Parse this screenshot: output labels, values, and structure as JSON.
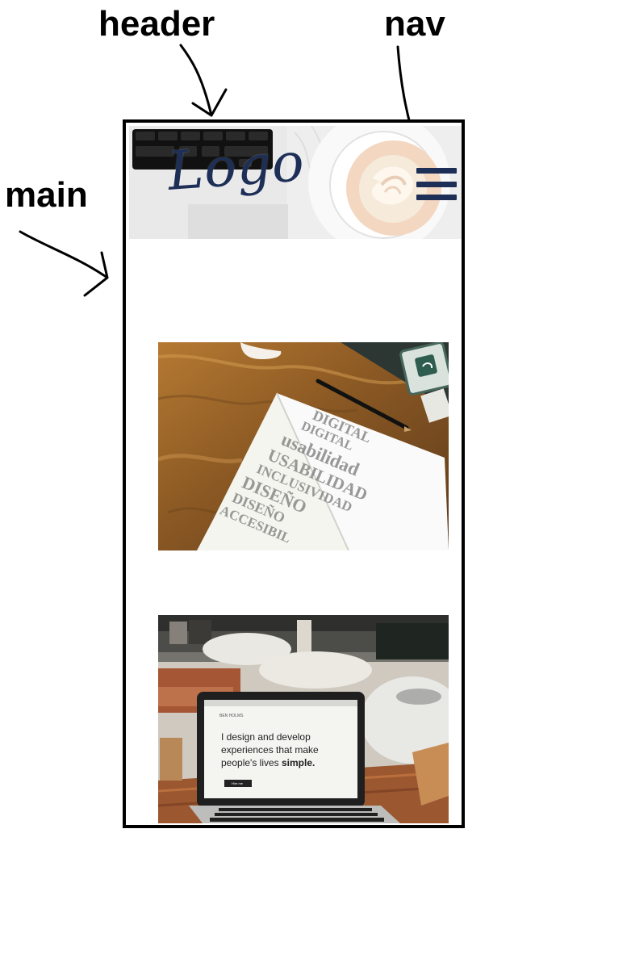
{
  "annotations": {
    "header": "header",
    "nav": "nav",
    "main": "main"
  },
  "site": {
    "logo": "Logo"
  },
  "notebook_image": {
    "lines": [
      "DIGITAL",
      "DIGITAL",
      "usabilidad",
      "USABILIDAD",
      "INCLUSIVIDAD",
      "DISEÑO",
      "DISEÑO",
      "ACCESIBIL"
    ]
  },
  "laptop_image": {
    "site_name": "BEN HOLMS",
    "headline_line1": "I design and develop",
    "headline_line2": "experiences that make",
    "headline_line3_prefix": "people's lives ",
    "headline_line3_emphasis": "simple.",
    "button": "Hire me"
  },
  "icons": {
    "menu": "hamburger-menu-icon"
  },
  "colors": {
    "logo": "#1d2f57",
    "menu": "#1d2f57",
    "frame": "#000000"
  }
}
